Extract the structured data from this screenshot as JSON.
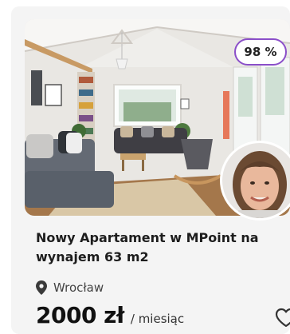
{
  "listing": {
    "match_badge": "98 %",
    "title": "Nowy Apartament w MPoint na wynajem 63 m2",
    "location": "Wrocław",
    "price": "2000 zł",
    "price_period": "/ miesiąc"
  },
  "icons": {
    "location": "map-pin-icon",
    "favorite": "heart-outline-icon"
  },
  "colors": {
    "badge_border": "#8b4fc9",
    "card_background": "#f4f4f4"
  }
}
